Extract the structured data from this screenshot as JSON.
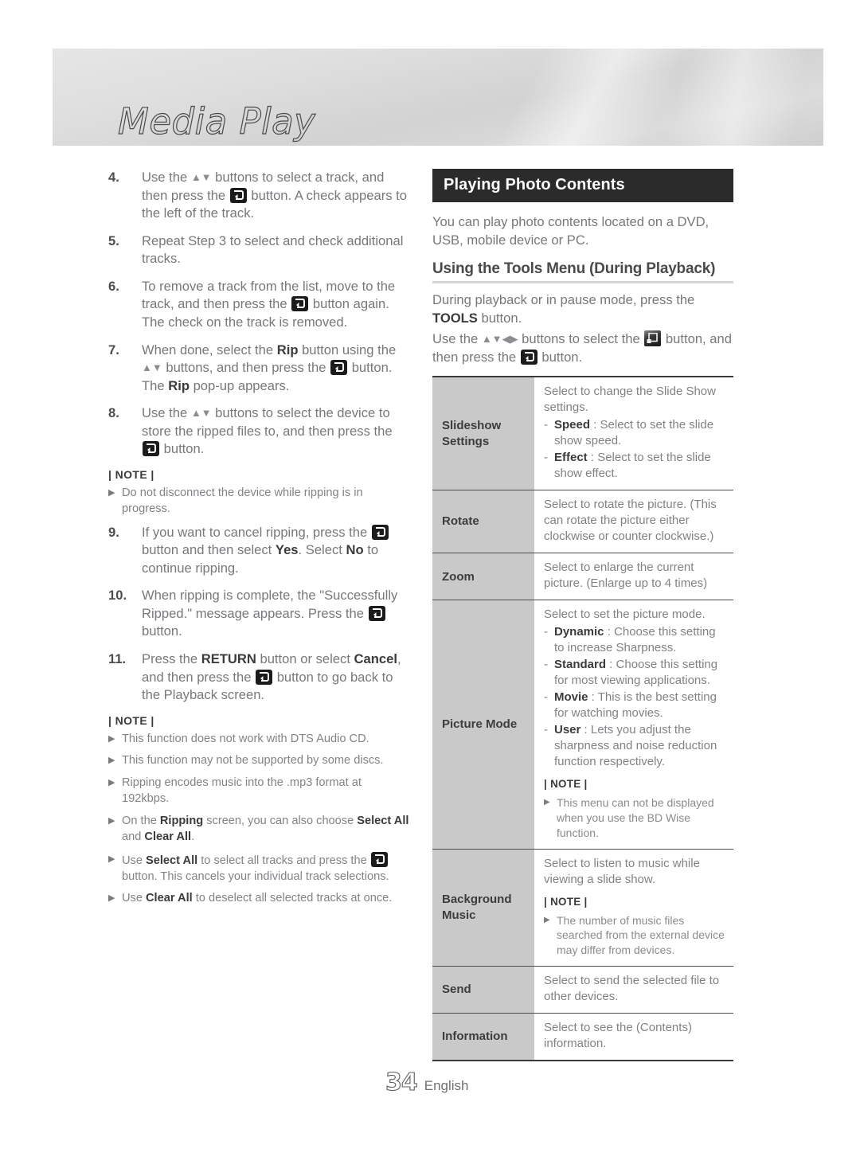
{
  "banner": {
    "title": "Media Play"
  },
  "icons": {
    "enter": "enter-button-icon",
    "tools": "tools-button-icon",
    "updown": "▲▼",
    "updownleftright": "▲▼◀▶"
  },
  "left_column": {
    "steps": [
      {
        "number": "4.",
        "parts": [
          {
            "t": "Use the "
          },
          {
            "arrows": "▲▼"
          },
          {
            "t": " buttons to select a track, and then press the "
          },
          {
            "icon": "enter"
          },
          {
            "t": " button. A check appears to the left of the track."
          }
        ]
      },
      {
        "number": "5.",
        "parts": [
          {
            "t": "Repeat Step 3 to select and check additional tracks."
          }
        ]
      },
      {
        "number": "6.",
        "parts": [
          {
            "t": "To remove a track from the list, move to the track, and then press the "
          },
          {
            "icon": "enter"
          },
          {
            "t": " button again."
          },
          {
            "br": true
          },
          {
            "t": "The check on the track is removed."
          }
        ]
      },
      {
        "number": "7.",
        "parts": [
          {
            "t": "When done, select the "
          },
          {
            "b": "Rip"
          },
          {
            "t": " button using the "
          },
          {
            "arrows": "▲▼"
          },
          {
            "t": " buttons, and then press the "
          },
          {
            "icon": "enter"
          },
          {
            "t": " button. The "
          },
          {
            "b": "Rip"
          },
          {
            "t": " pop-up appears."
          }
        ]
      },
      {
        "number": "8.",
        "parts": [
          {
            "t": "Use the "
          },
          {
            "arrows": "▲▼"
          },
          {
            "t": " buttons to select the device to store the ripped files to, and then press the "
          },
          {
            "icon": "enter"
          },
          {
            "t": " button."
          }
        ]
      }
    ],
    "note1": {
      "head": "| NOTE |",
      "items": [
        [
          {
            "t": "Do not disconnect the device while ripping is in progress."
          }
        ]
      ]
    },
    "steps2": [
      {
        "number": "9.",
        "parts": [
          {
            "t": "If you want to cancel ripping, press the "
          },
          {
            "icon": "enter"
          },
          {
            "t": " button and then select "
          },
          {
            "b": "Yes"
          },
          {
            "t": ". Select "
          },
          {
            "b": "No"
          },
          {
            "t": " to continue ripping."
          }
        ]
      },
      {
        "number": "10.",
        "parts": [
          {
            "t": "When ripping is complete, the \"Successfully Ripped.\" message appears. Press the "
          },
          {
            "icon": "enter"
          },
          {
            "t": " button."
          }
        ]
      },
      {
        "number": "11.",
        "parts": [
          {
            "t": "Press the "
          },
          {
            "b": "RETURN"
          },
          {
            "t": " button or select "
          },
          {
            "b": "Cancel"
          },
          {
            "t": ", and then press the "
          },
          {
            "icon": "enter"
          },
          {
            "t": " button to go back to the Playback screen."
          }
        ]
      }
    ],
    "note2": {
      "head": "| NOTE |",
      "items": [
        [
          {
            "t": "This function does not work with DTS Audio CD."
          }
        ],
        [
          {
            "t": "This function may not be supported by some discs."
          }
        ],
        [
          {
            "t": "Ripping encodes music into the .mp3 format at 192kbps."
          }
        ],
        [
          {
            "t": "On the "
          },
          {
            "b": "Ripping"
          },
          {
            "t": " screen, you can also choose "
          },
          {
            "b": "Select All"
          },
          {
            "t": " and "
          },
          {
            "b": "Clear All"
          },
          {
            "t": "."
          }
        ],
        [
          {
            "t": "Use "
          },
          {
            "b": "Select All"
          },
          {
            "t": " to select all tracks and press the "
          },
          {
            "icon": "enter"
          },
          {
            "t": " button. This cancels your individual track selections."
          }
        ],
        [
          {
            "t": "Use "
          },
          {
            "b": "Clear All"
          },
          {
            "t": " to deselect all selected tracks at once."
          }
        ]
      ]
    }
  },
  "right_column": {
    "section_title": "Playing Photo Contents",
    "intro": "You can play photo contents located on a DVD, USB, mobile device or PC.",
    "subsection_title": "Using the Tools Menu (During Playback)",
    "body_lines": [
      [
        {
          "t": "During playback or in pause mode, press the "
        },
        {
          "b": "TOOLS"
        },
        {
          "t": " button."
        }
      ],
      [
        {
          "t": "Use the "
        },
        {
          "arrows": "▲▼◀▶"
        },
        {
          "t": " buttons to select the "
        },
        {
          "icon": "tools"
        },
        {
          "t": " button, and then press the "
        },
        {
          "icon": "enter"
        },
        {
          "t": " button."
        }
      ]
    ],
    "table_rows": [
      {
        "label": "Slideshow Settings",
        "blocks": [
          {
            "type": "p",
            "parts": [
              {
                "t": "Select to change the Slide Show settings."
              }
            ]
          },
          {
            "type": "dash",
            "parts": [
              {
                "b": "Speed"
              },
              {
                "t": " : Select to set the slide show speed."
              }
            ]
          },
          {
            "type": "dash",
            "parts": [
              {
                "b": "Effect"
              },
              {
                "t": " : Select to set the slide show effect."
              }
            ]
          }
        ]
      },
      {
        "label": "Rotate",
        "blocks": [
          {
            "type": "p",
            "parts": [
              {
                "t": "Select to rotate the picture. (This can rotate the picture either clockwise or counter clockwise.)"
              }
            ]
          }
        ]
      },
      {
        "label": "Zoom",
        "blocks": [
          {
            "type": "p",
            "parts": [
              {
                "t": "Select to enlarge the current picture. (Enlarge up to 4 times)"
              }
            ]
          }
        ]
      },
      {
        "label": "Picture Mode",
        "blocks": [
          {
            "type": "p",
            "parts": [
              {
                "t": "Select to set the picture mode."
              }
            ]
          },
          {
            "type": "dash",
            "parts": [
              {
                "b": "Dynamic"
              },
              {
                "t": " : Choose this setting to increase Sharpness."
              }
            ]
          },
          {
            "type": "dash",
            "parts": [
              {
                "b": "Standard"
              },
              {
                "t": " : Choose this setting for most viewing applications."
              }
            ]
          },
          {
            "type": "dash",
            "parts": [
              {
                "b": "Movie"
              },
              {
                "t": " : This is the best setting for watching movies."
              }
            ]
          },
          {
            "type": "dash",
            "parts": [
              {
                "b": "User"
              },
              {
                "t": " : Lets you adjust the sharpness and noise reduction function respectively."
              }
            ]
          },
          {
            "type": "notehead",
            "text": "| NOTE |"
          },
          {
            "type": "note",
            "parts": [
              {
                "t": "This menu can not be displayed when you use the BD Wise function."
              }
            ]
          }
        ]
      },
      {
        "label": "Background Music",
        "blocks": [
          {
            "type": "p",
            "parts": [
              {
                "t": "Select to listen to music while viewing a slide show."
              }
            ]
          },
          {
            "type": "notehead",
            "text": "| NOTE |"
          },
          {
            "type": "note",
            "parts": [
              {
                "t": "The number of music files searched from the external device may differ from devices."
              }
            ]
          }
        ]
      },
      {
        "label": "Send",
        "blocks": [
          {
            "type": "p",
            "parts": [
              {
                "t": "Select to send the selected file to other devices."
              }
            ]
          }
        ]
      },
      {
        "label": "Information",
        "blocks": [
          {
            "type": "p",
            "parts": [
              {
                "t": "Select to see the (Contents) information."
              }
            ]
          }
        ]
      }
    ]
  },
  "footer": {
    "page_number": "34",
    "language": "English"
  },
  "colors": {
    "section_bar_bg": "#2b2b2b",
    "table_label_bg": "#c9c9c9",
    "body_text": "#77787b",
    "bold_text": "#3b3b3d"
  }
}
